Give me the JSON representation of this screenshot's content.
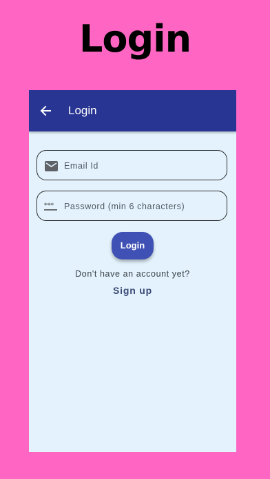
{
  "hero": {
    "title": "Login"
  },
  "appbar": {
    "title": "Login",
    "back_icon": "arrow-back-icon"
  },
  "form": {
    "email": {
      "placeholder": "Email Id",
      "icon": "mail-icon"
    },
    "password": {
      "placeholder": "Password (min 6 characters)",
      "icon": "password-icon"
    },
    "login_label": "Login"
  },
  "footer": {
    "prompt": "Don't have an account yet?",
    "signup_label": "Sign up"
  },
  "colors": {
    "background": "#ff66c4",
    "screen": "#e3f2fc",
    "appbar": "#283593",
    "button": "#3f51b5",
    "link": "#3b4a74"
  }
}
